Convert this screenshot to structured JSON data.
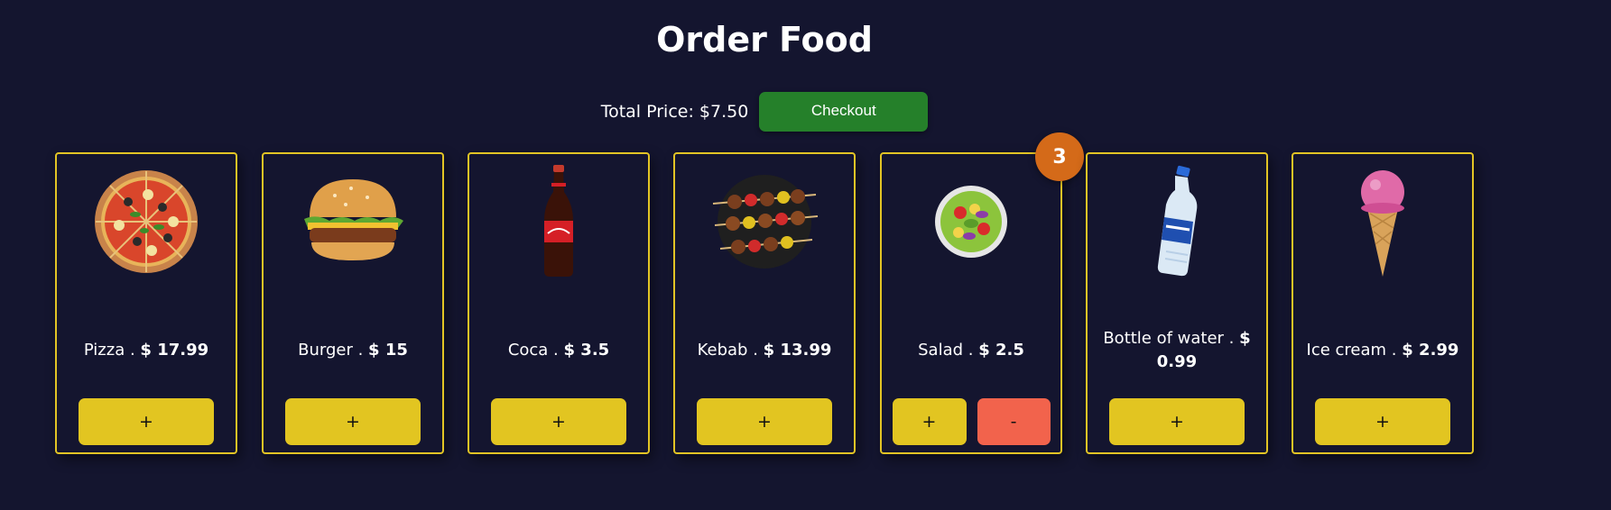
{
  "header": {
    "title": "Order Food"
  },
  "summary": {
    "total_label": "Total Price: $7.50",
    "checkout_label": "Checkout"
  },
  "items": [
    {
      "name": "Pizza . ",
      "price": "$ 17.99",
      "add": "+",
      "icon": "pizza-icon"
    },
    {
      "name": "Burger . ",
      "price": "$ 15",
      "add": "+",
      "icon": "burger-icon"
    },
    {
      "name": "Coca . ",
      "price": "$ 3.5",
      "add": "+",
      "icon": "cola-bottle-icon"
    },
    {
      "name": "Kebab . ",
      "price": "$ 13.99",
      "add": "+",
      "icon": "kebab-icon"
    },
    {
      "name": "Salad . ",
      "price": "$ 2.5",
      "add": "+",
      "remove": "-",
      "quantity": "3",
      "icon": "salad-icon"
    },
    {
      "name": "Bottle of water . ",
      "price": "$ 0.99",
      "add": "+",
      "icon": "water-bottle-icon"
    },
    {
      "name": "Ice cream . ",
      "price": "$ 2.99",
      "add": "+",
      "icon": "ice-cream-icon"
    }
  ],
  "colors": {
    "background": "#14152f",
    "card_border": "#e2c425",
    "add_button": "#e2c521",
    "remove_button": "#f2634c",
    "checkout_button": "#25802a",
    "badge": "#d46a19"
  }
}
